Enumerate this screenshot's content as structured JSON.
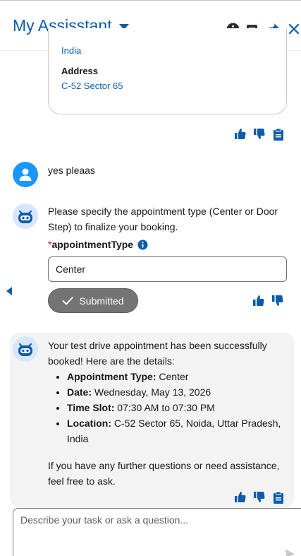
{
  "header": {
    "title": "My Assisstant",
    "icons": [
      "info-icon",
      "end-chat-icon",
      "pin-icon",
      "close-icon"
    ]
  },
  "record_card": {
    "country": "India",
    "address_label": "Address",
    "address_value": "C-52 Sector 65"
  },
  "user_message": "yes pleaas",
  "bot_prompt": {
    "text": "Please specify the appointment type (Center or Door Step) to finalize your booking.",
    "field_label": "appointmentType",
    "required_mark": "*",
    "field_value": "Center",
    "submitted_label": "Submitted"
  },
  "confirmation": {
    "intro": "Your test drive appointment has been successfully booked! Here are the details:",
    "details": [
      {
        "label": "Appointment Type:",
        "value": " Center"
      },
      {
        "label": "Date:",
        "value": " Wednesday, May 13, 2026"
      },
      {
        "label": "Time Slot:",
        "value": " 07:30 AM to 07:30 PM"
      },
      {
        "label": "Location:",
        "value": " C-52 Sector 65, Noida, Uttar Pradesh, India"
      }
    ],
    "closing": "If you have any further questions or need assistance, feel free to ask."
  },
  "composer": {
    "placeholder": "Describe your task or ask a question..."
  },
  "colors": {
    "brand": "#0b5cab",
    "user_avatar": "#1b96ff",
    "bot_avatar_bg": "#d8e6fe",
    "submitted_button": "#747474",
    "bubble_bg": "#f3f3f3"
  }
}
